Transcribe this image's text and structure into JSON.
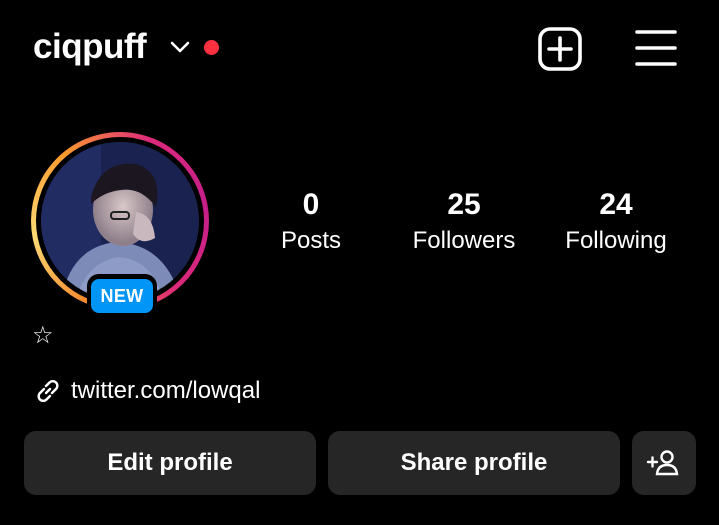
{
  "header": {
    "username": "ciqpuff",
    "icons": [
      "chevron-down-icon",
      "notification-dot",
      "new-post-icon",
      "menu-icon"
    ],
    "dot_color": "#ff3040"
  },
  "profile": {
    "badge": "NEW",
    "stats": [
      {
        "value": "0",
        "label": "Posts"
      },
      {
        "value": "25",
        "label": "Followers"
      },
      {
        "value": "24",
        "label": "Following"
      }
    ],
    "bio": "☆",
    "link": "twitter.com/lowqal"
  },
  "actions": {
    "edit": "Edit profile",
    "share": "Share profile",
    "discover_icon": "add-person-icon"
  },
  "colors": {
    "background": "#000000",
    "button": "#262626",
    "badge": "#0095f6"
  }
}
